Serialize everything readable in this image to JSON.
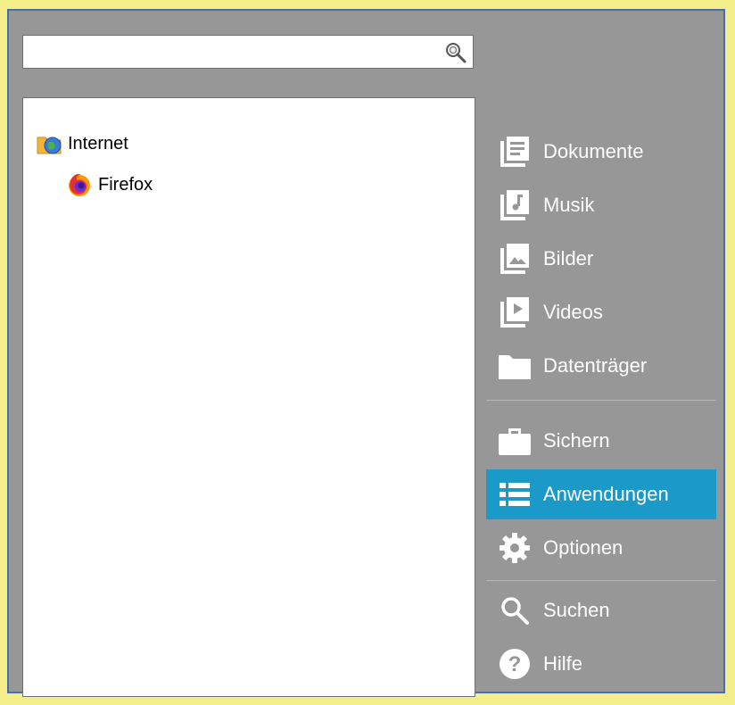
{
  "search": {
    "value": "",
    "placeholder": ""
  },
  "tree": [
    {
      "label": "Internet",
      "icon": "internet-folder-icon"
    },
    {
      "label": "Firefox",
      "icon": "firefox-icon"
    }
  ],
  "sidebar": {
    "items": [
      {
        "label": "Dokumente",
        "icon": "documents-icon"
      },
      {
        "label": "Musik",
        "icon": "music-icon"
      },
      {
        "label": "Bilder",
        "icon": "pictures-icon"
      },
      {
        "label": "Videos",
        "icon": "videos-icon"
      },
      {
        "label": "Datenträger",
        "icon": "folder-icon"
      },
      {
        "label": "Sichern",
        "icon": "briefcase-icon"
      },
      {
        "label": "Anwendungen",
        "icon": "list-icon",
        "active": true
      },
      {
        "label": "Optionen",
        "icon": "gear-icon"
      },
      {
        "label": "Suchen",
        "icon": "search-icon"
      },
      {
        "label": "Hilfe",
        "icon": "help-icon"
      }
    ]
  },
  "colors": {
    "background": "#979797",
    "active": "#1b99c8",
    "frame_border": "#4a6ea5",
    "outer": "#f3ee8a"
  }
}
